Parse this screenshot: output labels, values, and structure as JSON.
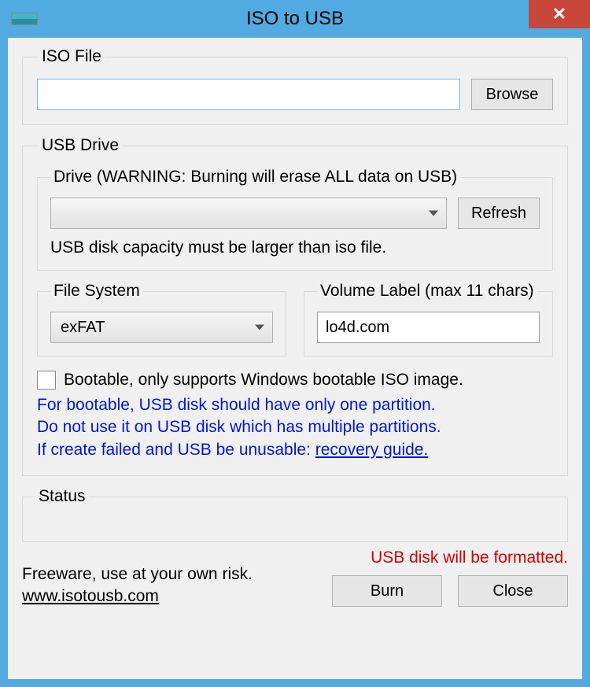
{
  "window": {
    "title": "ISO to USB",
    "close_glyph": "✕"
  },
  "iso_file": {
    "legend": "ISO File",
    "value": "",
    "browse_label": "Browse"
  },
  "usb_drive": {
    "legend": "USB Drive",
    "drive": {
      "legend": "Drive (WARNING: Burning will erase ALL data on USB)",
      "selected": "",
      "refresh_label": "Refresh",
      "capacity_note": "USB disk capacity must be larger than iso file."
    },
    "file_system": {
      "legend": "File System",
      "selected": "exFAT"
    },
    "volume_label": {
      "legend": "Volume Label (max 11 chars)",
      "value": "lo4d.com"
    },
    "bootable": {
      "checked": false,
      "label": "Bootable, only supports Windows bootable ISO image."
    },
    "hint_line1": "For bootable, USB disk should have only one partition.",
    "hint_line2": "Do not use it on USB disk which has multiple partitions.",
    "hint_line3_prefix": "If create failed and USB be unusable: ",
    "hint_link": "recovery guide."
  },
  "status": {
    "legend": "Status",
    "text": ""
  },
  "footer": {
    "freeware_text": "Freeware, use at your own risk.",
    "site_link": "www.isotousb.com",
    "format_warning": "USB disk will be formatted.",
    "burn_label": "Burn",
    "close_label": "Close"
  }
}
